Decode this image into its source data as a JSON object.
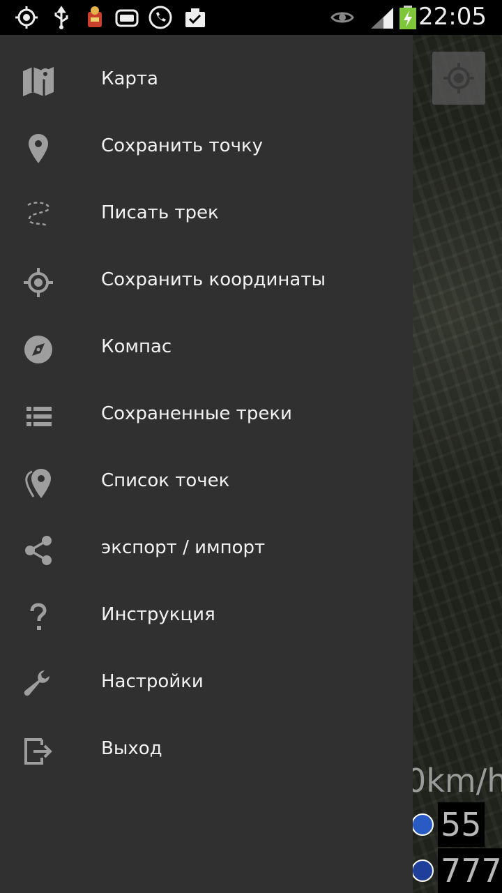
{
  "status_bar": {
    "time": "22:05"
  },
  "map": {
    "speed_label": "0km/h",
    "sign_value_1": "55",
    "sign_value_2": "777"
  },
  "menu": {
    "items": [
      {
        "label": "Карта",
        "icon": "map-icon"
      },
      {
        "label": "Сохранить точку",
        "icon": "location-pin-icon"
      },
      {
        "label": "Писать трек",
        "icon": "track-icon"
      },
      {
        "label": "Сохранить координаты",
        "icon": "crosshair-icon"
      },
      {
        "label": "Компас",
        "icon": "compass-icon"
      },
      {
        "label": "Сохраненные треки",
        "icon": "list-icon"
      },
      {
        "label": "Список точек",
        "icon": "pin-list-icon"
      },
      {
        "label": "экспорт / импорт",
        "icon": "share-icon"
      },
      {
        "label": "Инструкция",
        "icon": "help-icon"
      },
      {
        "label": "Настройки",
        "icon": "wrench-icon"
      },
      {
        "label": "Выход",
        "icon": "exit-icon"
      }
    ]
  },
  "colors": {
    "drawer_bg": "#303030",
    "icon_gray": "#9e9e9e",
    "text": "#f2f2f2"
  }
}
